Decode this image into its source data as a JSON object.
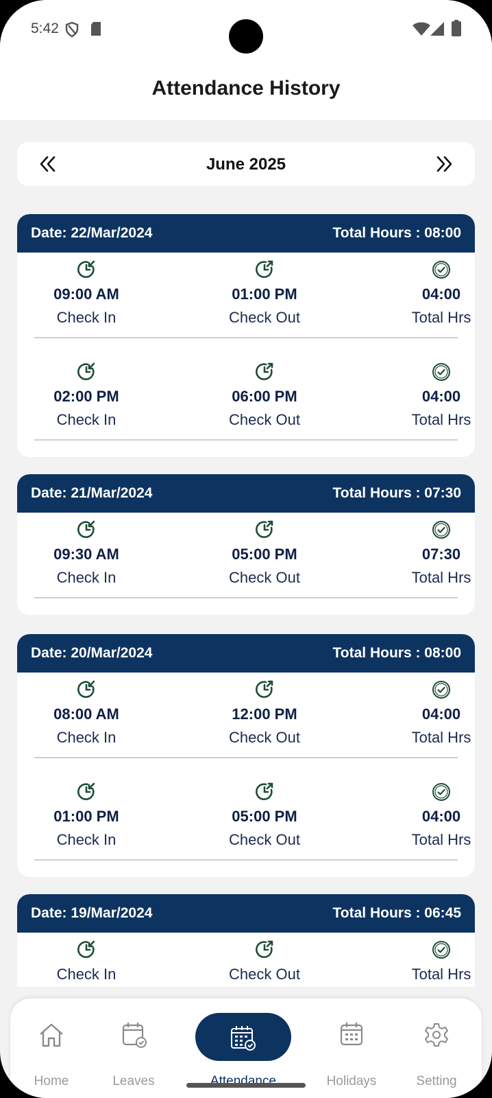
{
  "status": {
    "time": "5:42"
  },
  "header": {
    "title": "Attendance History"
  },
  "month_picker": {
    "label": "June 2025"
  },
  "cards": [
    {
      "date": "Date: 22/Mar/2024",
      "total": "Total Hours : 08:00",
      "entries": [
        {
          "in": "09:00 AM",
          "out": "01:00 PM",
          "hrs": "04:00"
        },
        {
          "in": "02:00 PM",
          "out": "06:00 PM",
          "hrs": "04:00"
        }
      ]
    },
    {
      "date": "Date: 21/Mar/2024",
      "total": "Total Hours : 07:30",
      "entries": [
        {
          "in": "09:30 AM",
          "out": "05:00 PM",
          "hrs": "07:30"
        }
      ]
    },
    {
      "date": "Date: 20/Mar/2024",
      "total": "Total Hours : 08:00",
      "entries": [
        {
          "in": "08:00 AM",
          "out": "12:00 PM",
          "hrs": "04:00"
        },
        {
          "in": "01:00 PM",
          "out": "05:00 PM",
          "hrs": "04:00"
        }
      ]
    },
    {
      "date": "Date: 19/Mar/2024",
      "total": "Total Hours : 06:45",
      "entries": [
        {
          "in": "",
          "out": "",
          "hrs": ""
        }
      ]
    }
  ],
  "labels": {
    "check_in": "Check In",
    "check_out": "Check Out",
    "total_hrs": "Total Hrs"
  },
  "nav": {
    "items": [
      {
        "label": "Home",
        "icon": "home-icon"
      },
      {
        "label": "Leaves",
        "icon": "calendar-check-icon"
      },
      {
        "label": "Attendance",
        "icon": "attendance-calendar-icon"
      },
      {
        "label": "Holidays",
        "icon": "calendar-icon"
      },
      {
        "label": "Setting",
        "icon": "gear-icon"
      }
    ],
    "active": "Attendance"
  },
  "colors": {
    "primary": "#0d3360",
    "icon_green": "#1e4d36",
    "background": "#f2f2f2"
  }
}
